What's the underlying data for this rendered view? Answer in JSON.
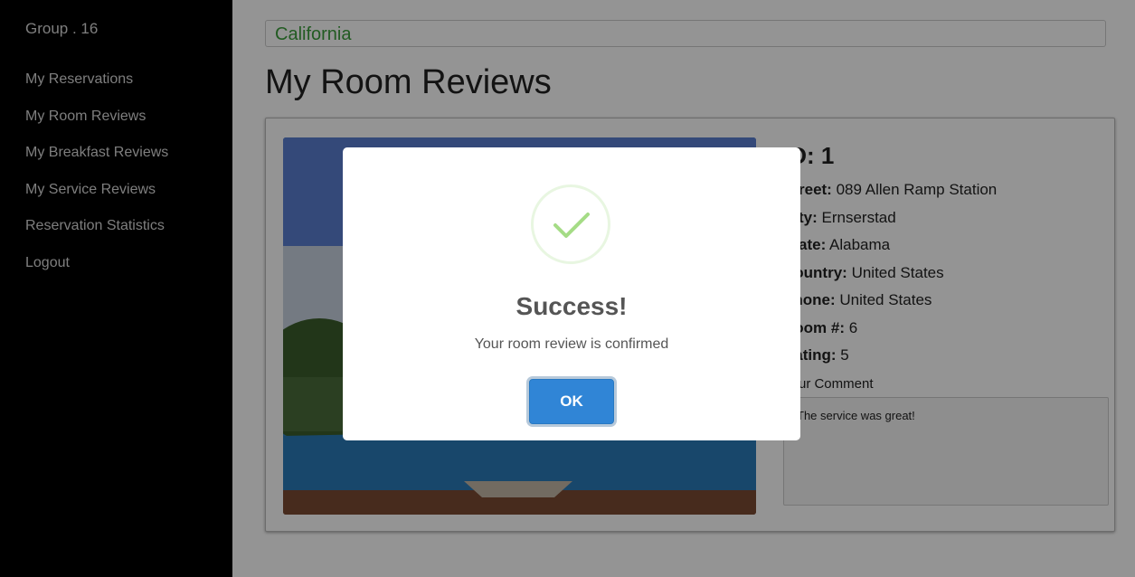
{
  "sidebar": {
    "brand": "Group . 16",
    "items": [
      {
        "label": "My Reservations"
      },
      {
        "label": "My Room Reviews"
      },
      {
        "label": "My Breakfast Reviews"
      },
      {
        "label": "My Service Reviews"
      },
      {
        "label": "Reservation Statistics"
      },
      {
        "label": "Logout"
      }
    ]
  },
  "main": {
    "location": "California",
    "title": "My Room Reviews",
    "review": {
      "id_label": "ID:",
      "id_value": "1",
      "fields": [
        {
          "label": "Street:",
          "value": "089 Allen Ramp Station"
        },
        {
          "label": "City:",
          "value": "Ernserstad"
        },
        {
          "label": "State:",
          "value": "Alabama"
        },
        {
          "label": "Country:",
          "value": "United States"
        },
        {
          "label": "Phone:",
          "value": "United States"
        },
        {
          "label": "Room #:",
          "value": "6"
        },
        {
          "label": "Rating:",
          "value": "5"
        }
      ],
      "comment_label": "Your Comment",
      "comment": "The service was great!"
    }
  },
  "modal": {
    "icon": "check-icon",
    "title": "Success!",
    "message": "Your room review is confirmed",
    "ok_label": "OK",
    "accent": "#3085d6",
    "check_color": "#a5dc86"
  }
}
